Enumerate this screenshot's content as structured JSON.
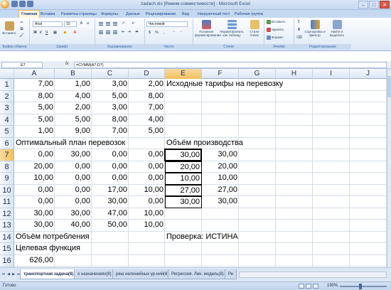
{
  "window": {
    "title": "zadach.xls  [Режим совместимости] - Microsoft Excel",
    "controls": [
      "–",
      "□",
      "✕"
    ]
  },
  "ribbon": {
    "tabs": [
      "Главная",
      "Вставка",
      "Разметка страницы",
      "Формулы",
      "Данные",
      "Рецензирование",
      "Вид",
      "Нагрузочный тест",
      "Рабочая группа"
    ],
    "active_tab": "Главная",
    "groups": {
      "clipboard": {
        "label": "Буфер обмена",
        "paste": "Вставить"
      },
      "font": {
        "label": "Шрифт",
        "name": "Arial",
        "size": "10"
      },
      "alignment": {
        "label": "Выравнивание"
      },
      "number": {
        "label": "Число",
        "format": "Числовой"
      },
      "styles": {
        "label": "Стили",
        "conditional": "Условное форматирование",
        "as_table": "Форматировать как таблицу",
        "cell_styles": "Стили ячеек"
      },
      "cells": {
        "label": "Ячейки",
        "insert": "Вставить",
        "delete": "Удалить",
        "format": "Формат"
      },
      "editing": {
        "label": "Редактирование",
        "sort": "Сортировка и фильтр",
        "find": "Найти и выделить"
      }
    }
  },
  "formula_bar": {
    "cell_ref": "E7",
    "fx": "fx",
    "formula": "=СУММ(A7:D7)"
  },
  "columns": [
    "A",
    "B",
    "C",
    "D",
    "E",
    "F",
    "G",
    "H",
    "I",
    "J"
  ],
  "selected": {
    "column": "E",
    "row": "7"
  },
  "rows": [
    {
      "n": "1",
      "cells": {
        "A": "7,00",
        "B": "1,00",
        "C": "3,00",
        "D": "2,00",
        "E": "Исходные тарифы на перевозку"
      }
    },
    {
      "n": "2",
      "cells": {
        "A": "8,00",
        "B": "4,00",
        "C": "5,00",
        "D": "8,00"
      }
    },
    {
      "n": "3",
      "cells": {
        "A": "5,00",
        "B": "2,00",
        "C": "3,00",
        "D": "7,00"
      }
    },
    {
      "n": "4",
      "cells": {
        "A": "5,00",
        "B": "5,00",
        "C": "8,00",
        "D": "4,00"
      }
    },
    {
      "n": "5",
      "cells": {
        "A": "1,00",
        "B": "9,00",
        "C": "7,00",
        "D": "5,00"
      }
    },
    {
      "n": "6",
      "cells": {
        "A": "Оптимальный  план перевозок",
        "E": "Объём производства"
      }
    },
    {
      "n": "7",
      "cells": {
        "A": "0,00",
        "B": "30,00",
        "C": "0,00",
        "D": "0,00",
        "E": "30,00",
        "F": "30,00"
      }
    },
    {
      "n": "8",
      "cells": {
        "A": "20,00",
        "B": "0,00",
        "C": "0,00",
        "D": "0,00",
        "E": "20,00",
        "F": "20,00"
      }
    },
    {
      "n": "9",
      "cells": {
        "A": "10,00",
        "B": "0,00",
        "C": "0,00",
        "D": "0,00",
        "E": "10,00",
        "F": "10,00"
      }
    },
    {
      "n": "10",
      "cells": {
        "A": "0,00",
        "B": "0,00",
        "C": "17,00",
        "D": "10,00",
        "E": "27,00",
        "F": "27,00"
      }
    },
    {
      "n": "11",
      "cells": {
        "A": "0,00",
        "B": "0,00",
        "C": "30,00",
        "D": "0,00",
        "E": "30,00",
        "F": "30,00"
      }
    },
    {
      "n": "12",
      "cells": {
        "A": "30,00",
        "B": "30,00",
        "C": "47,00",
        "D": "10,00"
      }
    },
    {
      "n": "13",
      "cells": {
        "A": "30,00",
        "B": "40,00",
        "C": "50,00",
        "D": "10,00"
      }
    },
    {
      "n": "14",
      "cells": {
        "A": "Объём потребления",
        "E": "Проверка: ИСТИНА"
      }
    },
    {
      "n": "15",
      "cells": {
        "A": "Целевая функция"
      }
    },
    {
      "n": "16",
      "cells": {
        "A": "626,00"
      }
    },
    {
      "n": "17",
      "cells": {}
    }
  ],
  "sheet_tabs": [
    "транспортная задача(8)",
    "о назначениях(8)",
    "реш нелинейных ур-ний(8)",
    "Регрессия. Лин. модель(8)",
    "Ре"
  ],
  "active_sheet": "транспортная задача(8)",
  "status": {
    "ready": "Готово",
    "zoom": "190%"
  },
  "colors": {
    "ribbon_bg": "#dde8f5",
    "header_selected": "#f1c05e",
    "grid_line": "#d6dee8"
  }
}
